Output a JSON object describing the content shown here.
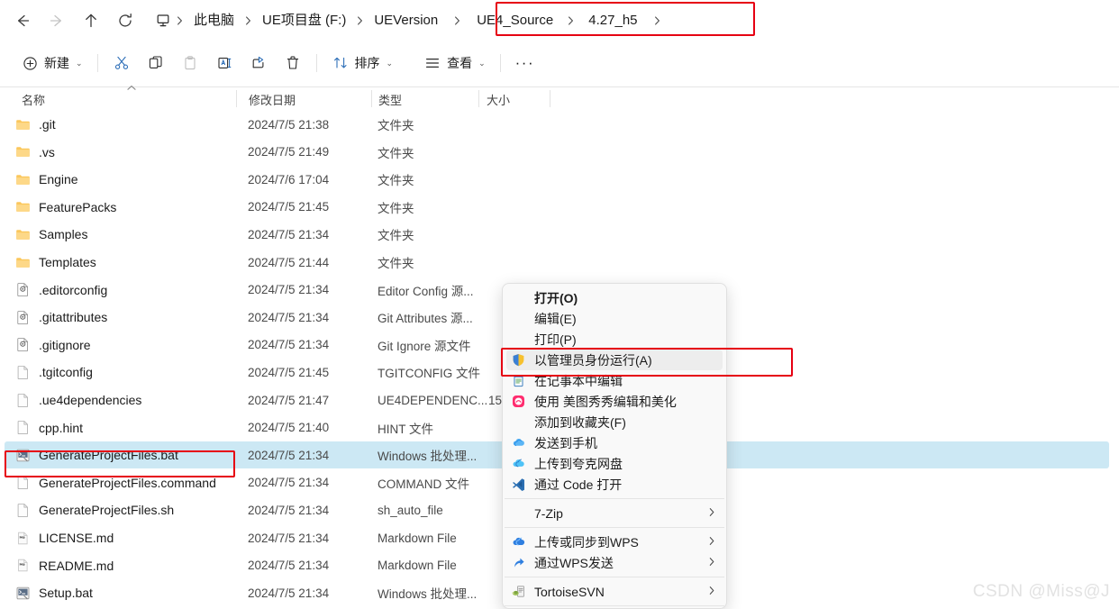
{
  "nav": {
    "back": "back-arrow",
    "forward": "forward-arrow",
    "up": "up-arrow",
    "refresh": "refresh"
  },
  "breadcrumb": {
    "icon": "this-pc-icon",
    "items": [
      "此电脑",
      "UE项目盘 (F:)",
      "UEVersion",
      "UE4_Source",
      "4.27_h5"
    ],
    "separator": "›"
  },
  "toolbar": {
    "new_label": "新建",
    "cut_label": "剪切",
    "copy_label": "复制",
    "paste_label": "粘贴",
    "rename_label": "重命名",
    "share_label": "共享",
    "delete_label": "删除",
    "sort_label": "排序",
    "view_label": "查看",
    "more_label": "···"
  },
  "columns": {
    "name": "名称",
    "date": "修改日期",
    "type": "类型",
    "size": "大小"
  },
  "files": [
    {
      "name": ".git",
      "date": "2024/7/5 21:38",
      "type": "文件夹",
      "size": "",
      "icon": "folder-icon",
      "selected": false
    },
    {
      "name": ".vs",
      "date": "2024/7/5 21:49",
      "type": "文件夹",
      "size": "",
      "icon": "folder-icon",
      "selected": false
    },
    {
      "name": "Engine",
      "date": "2024/7/6 17:04",
      "type": "文件夹",
      "size": "",
      "icon": "folder-icon",
      "selected": false
    },
    {
      "name": "FeaturePacks",
      "date": "2024/7/5 21:45",
      "type": "文件夹",
      "size": "",
      "icon": "folder-icon",
      "selected": false
    },
    {
      "name": "Samples",
      "date": "2024/7/5 21:34",
      "type": "文件夹",
      "size": "",
      "icon": "folder-icon",
      "selected": false
    },
    {
      "name": "Templates",
      "date": "2024/7/5 21:44",
      "type": "文件夹",
      "size": "",
      "icon": "folder-icon",
      "selected": false
    },
    {
      "name": ".editorconfig",
      "date": "2024/7/5 21:34",
      "type": "Editor Config 源...",
      "size": "",
      "icon": "gear-file-icon",
      "selected": false
    },
    {
      "name": ".gitattributes",
      "date": "2024/7/5 21:34",
      "type": "Git Attributes 源...",
      "size": "",
      "icon": "gear-file-icon",
      "selected": false
    },
    {
      "name": ".gitignore",
      "date": "2024/7/5 21:34",
      "type": "Git Ignore 源文件",
      "size": "",
      "icon": "gear-file-icon",
      "selected": false
    },
    {
      "name": ".tgitconfig",
      "date": "2024/7/5 21:45",
      "type": "TGITCONFIG 文件",
      "size": "",
      "icon": "blank-file-icon",
      "selected": false
    },
    {
      "name": ".ue4dependencies",
      "date": "2024/7/5 21:47",
      "type": "UE4DEPENDENC...",
      "size": "15",
      "icon": "blank-file-icon",
      "selected": false
    },
    {
      "name": "cpp.hint",
      "date": "2024/7/5 21:40",
      "type": "HINT 文件",
      "size": "",
      "icon": "blank-file-icon",
      "selected": false
    },
    {
      "name": "GenerateProjectFiles.bat",
      "date": "2024/7/5 21:34",
      "type": "Windows 批处理...",
      "size": "",
      "icon": "bat-file-icon",
      "selected": true
    },
    {
      "name": "GenerateProjectFiles.command",
      "date": "2024/7/5 21:34",
      "type": "COMMAND 文件",
      "size": "",
      "icon": "blank-file-icon",
      "selected": false
    },
    {
      "name": "GenerateProjectFiles.sh",
      "date": "2024/7/5 21:34",
      "type": "sh_auto_file",
      "size": "",
      "icon": "blank-file-icon",
      "selected": false
    },
    {
      "name": "LICENSE.md",
      "date": "2024/7/5 21:34",
      "type": "Markdown File",
      "size": "",
      "icon": "md-file-icon",
      "selected": false
    },
    {
      "name": "README.md",
      "date": "2024/7/5 21:34",
      "type": "Markdown File",
      "size": "",
      "icon": "md-file-icon",
      "selected": false
    },
    {
      "name": "Setup.bat",
      "date": "2024/7/5 21:34",
      "type": "Windows 批处理...",
      "size": "",
      "icon": "bat-file-icon",
      "selected": false
    }
  ],
  "context_menu": {
    "items": [
      {
        "label": "打开(O)",
        "icon": "",
        "bold": true,
        "arrow": false,
        "hover": false,
        "sep_after": false
      },
      {
        "label": "编辑(E)",
        "icon": "",
        "bold": false,
        "arrow": false,
        "hover": false,
        "sep_after": false
      },
      {
        "label": "打印(P)",
        "icon": "",
        "bold": false,
        "arrow": false,
        "hover": false,
        "sep_after": false
      },
      {
        "label": "以管理员身份运行(A)",
        "icon": "shield-icon",
        "bold": false,
        "arrow": false,
        "hover": true,
        "sep_after": false
      },
      {
        "label": "在记事本中编辑",
        "icon": "notepad-icon",
        "bold": false,
        "arrow": false,
        "hover": false,
        "sep_after": false
      },
      {
        "label": "使用 美图秀秀编辑和美化",
        "icon": "meitu-icon",
        "bold": false,
        "arrow": false,
        "hover": false,
        "sep_after": false
      },
      {
        "label": "添加到收藏夹(F)",
        "icon": "",
        "bold": false,
        "arrow": false,
        "hover": false,
        "sep_after": false
      },
      {
        "label": "发送到手机",
        "icon": "cloud-phone-icon",
        "bold": false,
        "arrow": false,
        "hover": false,
        "sep_after": false
      },
      {
        "label": "上传到夸克网盘",
        "icon": "quark-cloud-icon",
        "bold": false,
        "arrow": false,
        "hover": false,
        "sep_after": false
      },
      {
        "label": "通过 Code 打开",
        "icon": "vscode-icon",
        "bold": false,
        "arrow": false,
        "hover": false,
        "sep_after": true
      },
      {
        "label": "7-Zip",
        "icon": "",
        "bold": false,
        "arrow": true,
        "hover": false,
        "sep_after": true
      },
      {
        "label": "上传或同步到WPS",
        "icon": "wps-cloud-icon",
        "bold": false,
        "arrow": true,
        "hover": false,
        "sep_after": false
      },
      {
        "label": "通过WPS发送",
        "icon": "wps-share-icon",
        "bold": false,
        "arrow": true,
        "hover": false,
        "sep_after": true
      },
      {
        "label": "TortoiseSVN",
        "icon": "tortoisesvn-icon",
        "bold": false,
        "arrow": true,
        "hover": false,
        "sep_after": true
      }
    ]
  },
  "annotations": {
    "highlight_color": "#e60012",
    "selection_color": "#cce8f4"
  },
  "watermark": "CSDN @Miss@J"
}
